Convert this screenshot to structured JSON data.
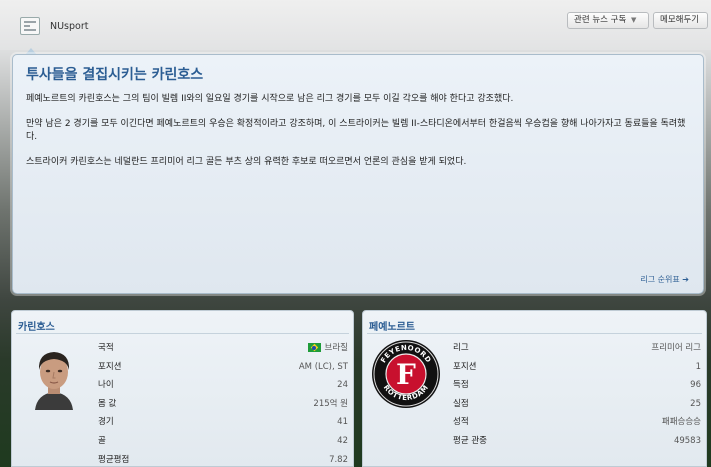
{
  "header": {
    "source": "NUsport",
    "subscribe_label": "관련 뉴스 구독",
    "memo_label": "메모해두기"
  },
  "news": {
    "title": "투사들을 결집시키는 카린호스",
    "paragraphs": [
      "페예노르트의 카린호스는 그의 팀이 빌렘 II와의 일요일 경기를 시작으로 남은 리그 경기를 모두 이길 각오를 해야 한다고 강조했다.",
      "만약 남은 2 경기를 모두 이긴다면 페예노르트의 우승은 확정적이라고 강조하며, 이 스트라이커는 빌렘 II-스타디온에서부터 한걸음씩 우승컵을 향해 나아가자고 동료들을 독려했다.",
      "스트라이커 카린호스는 네덜란드 프리미어 리그 골든 부츠 상의 유력한 후보로 떠오르면서 언론의 관심을 받게 되었다."
    ],
    "link_label": "리그 순위표 ➔"
  },
  "player": {
    "title": "카린호스",
    "rows": [
      {
        "k": "국적",
        "v": "브라질"
      },
      {
        "k": "포지션",
        "v": "AM (LC), ST"
      },
      {
        "k": "나이",
        "v": "24"
      },
      {
        "k": "몸 값",
        "v": "215억 원"
      },
      {
        "k": "경기",
        "v": "41"
      },
      {
        "k": "골",
        "v": "42"
      },
      {
        "k": "평균평점",
        "v": "7.82"
      }
    ]
  },
  "club": {
    "title": "페예노르트",
    "crest_top": "FEYENOORD",
    "crest_bottom": "ROTTERDAM",
    "crest_letter": "F",
    "rows": [
      {
        "k": "리그",
        "v": "프리미어 리그"
      },
      {
        "k": "포지션",
        "v": "1"
      },
      {
        "k": "득점",
        "v": "96"
      },
      {
        "k": "실점",
        "v": "25"
      },
      {
        "k": "성적",
        "v": "패패승승승"
      },
      {
        "k": "평균 관중",
        "v": "49583"
      }
    ]
  },
  "colors": {
    "accent": "#2b5d93",
    "crest_red": "#c8102e"
  }
}
